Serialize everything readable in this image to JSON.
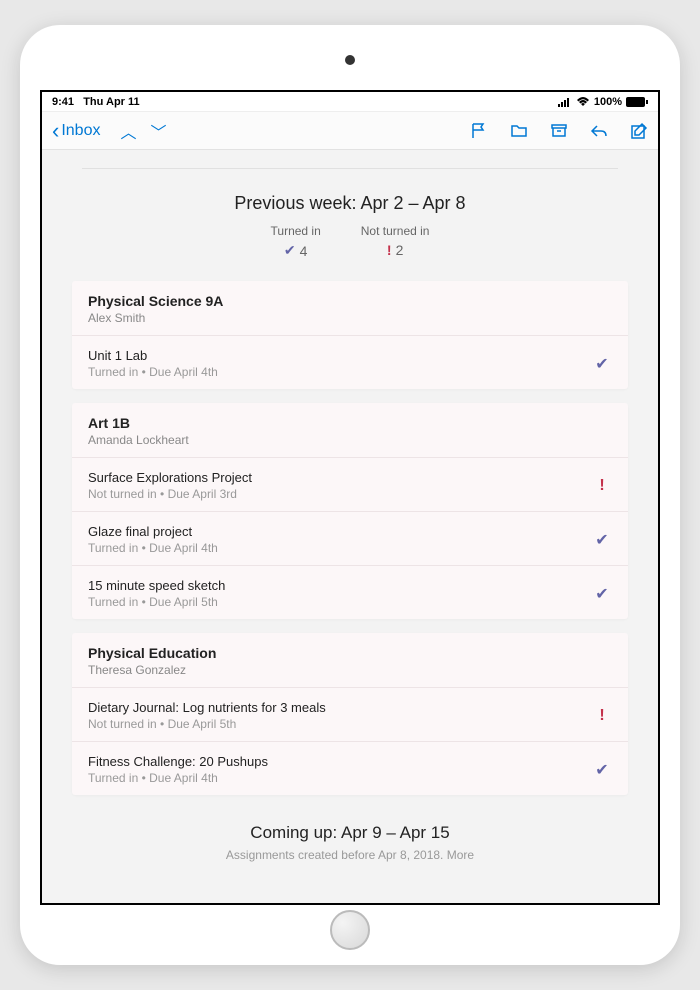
{
  "statusbar": {
    "time": "9:41",
    "day": "Thu Apr 11",
    "battery": "100%"
  },
  "navbar": {
    "back": "Inbox"
  },
  "heading": "Previous week: Apr 2 – Apr 8",
  "summary": {
    "turned_label": "Turned in",
    "turned_count": "4",
    "not_label": "Not turned in",
    "not_count": "2"
  },
  "sections": [
    {
      "title": "Physical Science 9A",
      "teacher": "Alex Smith",
      "items": [
        {
          "title": "Unit 1 Lab",
          "sub": "Turned in   •   Due April 4th",
          "status": "chk"
        }
      ]
    },
    {
      "title": "Art 1B",
      "teacher": "Amanda Lockheart",
      "items": [
        {
          "title": "Surface Explorations Project",
          "sub": "Not turned in   •   Due April 3rd",
          "status": "exc"
        },
        {
          "title": "Glaze final project",
          "sub": "Turned in   •   Due April 4th",
          "status": "chk"
        },
        {
          "title": "15 minute speed sketch",
          "sub": "Turned in   •   Due April 5th",
          "status": "chk"
        }
      ]
    },
    {
      "title": "Physical Education",
      "teacher": "Theresa Gonzalez",
      "items": [
        {
          "title": "Dietary Journal: Log nutrients for 3 meals",
          "sub": "Not turned in   •   Due April 5th",
          "status": "exc"
        },
        {
          "title": "Fitness Challenge: 20 Pushups",
          "sub": "Turned in   •   Due April 4th",
          "status": "chk"
        }
      ]
    }
  ],
  "coming": {
    "title": "Coming up: Apr 9 – Apr 15",
    "sub": "Assignments created before Apr 8, 2018. More"
  }
}
